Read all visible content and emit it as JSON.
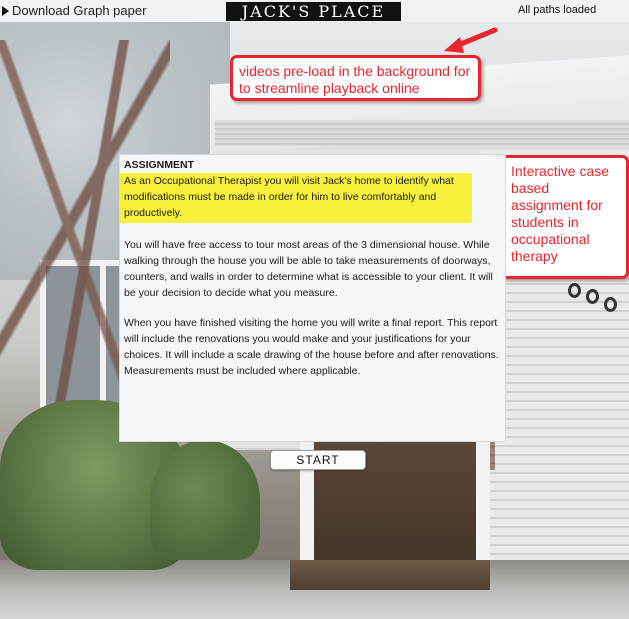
{
  "topbar": {
    "download_label": "Download Graph paper",
    "logo_text": "JACK'S PLACE",
    "status_text": "All paths loaded"
  },
  "callouts": {
    "preload_note": "videos pre-load in the background for to streamline playback online",
    "assignment_note": "Interactive case based assignment for students in occupational therapy"
  },
  "assignment": {
    "heading": "ASSIGNMENT",
    "highlight": "As an Occupational Therapist you will visit Jack's home to identify what modifications must be made in order for him to live comfortably and productively.",
    "paragraph_1": "You will have free access to tour most areas of the 3 dimensional house. While walking through the house you will be able to take measurements of doorways, counters, and walls in order to determine what is accessible to your client. It will be your decision to decide what you measure.",
    "paragraph_2": "When you have finished visiting the home you will write a final report. This report will include the renovations you would make and your justifications for your choices.  It will include a scale drawing of the house before and after renovations. Measurements must be included where applicable."
  },
  "start_button": {
    "label": "START"
  },
  "colors": {
    "callout_red": "#e8262b",
    "highlight_yellow": "#f7f03d",
    "logo_bg": "#111111"
  },
  "icons": {
    "download": "play-triangle-icon",
    "callout_arrow": "arrow-icon"
  }
}
